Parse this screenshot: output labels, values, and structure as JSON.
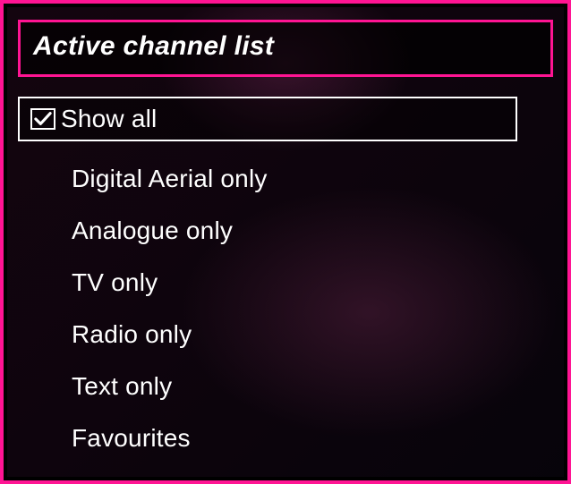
{
  "title": "Active channel list",
  "options": [
    {
      "label": "Show all",
      "selected": true,
      "checked": true
    },
    {
      "label": "Digital Aerial only",
      "selected": false,
      "checked": false
    },
    {
      "label": "Analogue only",
      "selected": false,
      "checked": false
    },
    {
      "label": "TV only",
      "selected": false,
      "checked": false
    },
    {
      "label": "Radio only",
      "selected": false,
      "checked": false
    },
    {
      "label": "Text only",
      "selected": false,
      "checked": false
    },
    {
      "label": "Favourites",
      "selected": false,
      "checked": false
    }
  ]
}
